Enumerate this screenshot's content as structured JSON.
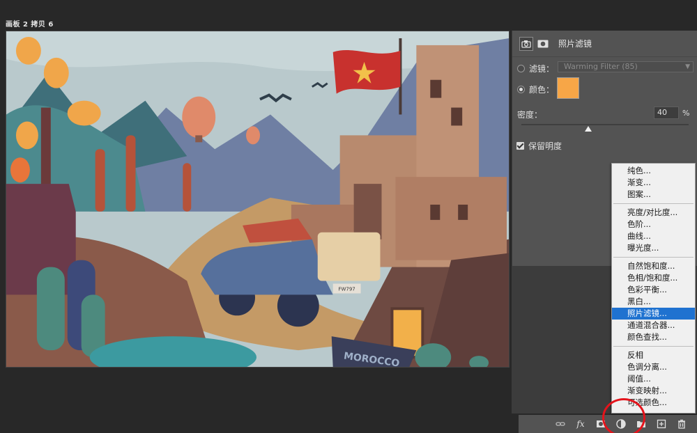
{
  "document": {
    "title": "画板 2 拷贝 6"
  },
  "canvas": {
    "sign_text": "MOROCCO",
    "plate_text": "FW797"
  },
  "properties": {
    "title": "照片滤镜",
    "filter_label": "滤镜：",
    "filter_value": "Warming Filter (85)",
    "color_label": "颜色：",
    "color_value": "#f7a647",
    "density_label": "密度：",
    "density_value": "40",
    "density_unit": "%",
    "density_level": 0.4,
    "preserve_label": "保留明度"
  },
  "menu": {
    "groups": [
      [
        "纯色...",
        "渐变...",
        "图案..."
      ],
      [
        "亮度/对比度...",
        "色阶...",
        "曲线...",
        "曝光度..."
      ],
      [
        "自然饱和度...",
        "色相/饱和度...",
        "色彩平衡...",
        "黑白...",
        "照片滤镜...",
        "通道混合器...",
        "颜色查找..."
      ],
      [
        "反相",
        "色调分离...",
        "阈值...",
        "渐变映射...",
        "可选颜色..."
      ]
    ],
    "selected": "照片滤镜..."
  },
  "toolbar": {
    "icons": [
      "link-icon",
      "fx-icon",
      "mask-icon",
      "adjustment-layer-icon",
      "folder-icon",
      "new-layer-icon",
      "trash-icon"
    ],
    "fx_label": "fx"
  },
  "colors": {
    "highlight": "#1f72d0",
    "annotation": "#e4141c",
    "panel": "#535353",
    "background": "#282828"
  }
}
